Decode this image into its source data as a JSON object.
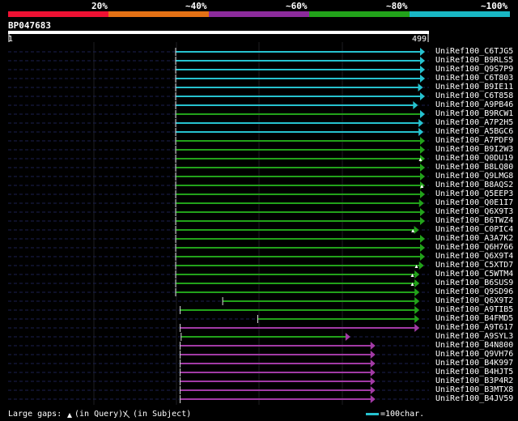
{
  "colors": {
    "bg": "#000000",
    "grid": "#1e1e22",
    "query_bar": "#ffffff",
    "dash": "#1b2050",
    "class_colors": [
      "#ee1133",
      "#e37115",
      "#8c2b9c",
      "#22a21a",
      "#19b7c4"
    ],
    "line_colors": {
      "c": "#26c2cf",
      "g": "#22a21a",
      "m": "#a23aa6"
    }
  },
  "legend": {
    "bins": [
      "20%",
      "~40%",
      "~60%",
      "~80%",
      "~100%"
    ]
  },
  "query": {
    "id": "BP047683",
    "start_label": "1",
    "end_label": "499",
    "length": 499
  },
  "hits": [
    {
      "id": "UniRef100_C6TJG5",
      "color": "c",
      "qs": 1,
      "qe": 499,
      "arrow": "c"
    },
    {
      "id": "UniRef100_B9RLS5",
      "color": "c",
      "qs": 1,
      "qe": 499,
      "arrow": "c"
    },
    {
      "id": "UniRef100_Q9S7P9",
      "color": "c",
      "qs": 1,
      "qe": 499,
      "arrow": "c"
    },
    {
      "id": "UniRef100_C6T803",
      "color": "c",
      "qs": 1,
      "qe": 499,
      "arrow": "c"
    },
    {
      "id": "UniRef100_B9IE11",
      "color": "c",
      "qs": 1,
      "qe": 495,
      "arrow": "c"
    },
    {
      "id": "UniRef100_C6T858",
      "color": "c",
      "qs": 1,
      "qe": 499,
      "arrow": "c"
    },
    {
      "id": "UniRef100_A9PB46",
      "color": "c",
      "qs": 1,
      "qe": 485,
      "arrow": "c"
    },
    {
      "id": "UniRef100_B9RCW1",
      "color": "g",
      "qs": 1,
      "qe": 499,
      "arrow": "c"
    },
    {
      "id": "UniRef100_A7P2H5",
      "color": "c",
      "qs": 1,
      "qe": 496,
      "arrow": "c"
    },
    {
      "id": "UniRef100_A5BGC6",
      "color": "c",
      "qs": 1,
      "qe": 496,
      "arrow": "c"
    },
    {
      "id": "UniRef100_A7PDF9",
      "color": "g",
      "qs": 1,
      "qe": 499,
      "arrow": "g"
    },
    {
      "id": "UniRef100_B9I2W3",
      "color": "g",
      "qs": 1,
      "qe": 499,
      "arrow": "g"
    },
    {
      "id": "UniRef100_Q0DU19",
      "color": "g",
      "qs": 1,
      "qe": 499,
      "arrow": "g",
      "gap": 490
    },
    {
      "id": "UniRef100_B8LQ80",
      "color": "g",
      "qs": 1,
      "qe": 499,
      "arrow": "g"
    },
    {
      "id": "UniRef100_Q9LMG8",
      "color": "g",
      "qs": 1,
      "qe": 499,
      "arrow": "g"
    },
    {
      "id": "UniRef100_B8AQS2",
      "color": "g",
      "qs": 1,
      "qe": 499,
      "arrow": "g",
      "gap": 493
    },
    {
      "id": "UniRef100_Q5EEP3",
      "color": "g",
      "qs": 1,
      "qe": 499,
      "arrow": "g"
    },
    {
      "id": "UniRef100_Q0E1I7",
      "color": "g",
      "qs": 1,
      "qe": 497,
      "arrow": "g"
    },
    {
      "id": "UniRef100_Q6X9T3",
      "color": "g",
      "qs": 1,
      "qe": 499,
      "arrow": "g"
    },
    {
      "id": "UniRef100_B6TWZ4",
      "color": "g",
      "qs": 1,
      "qe": 499,
      "arrow": "g"
    },
    {
      "id": "UniRef100_C0PIC4",
      "color": "g",
      "qs": 1,
      "qe": 487,
      "arrow": "g",
      "gap": 475
    },
    {
      "id": "UniRef100_A3A7K2",
      "color": "g",
      "qs": 1,
      "qe": 499,
      "arrow": "g"
    },
    {
      "id": "UniRef100_Q6H766",
      "color": "g",
      "qs": 1,
      "qe": 499,
      "arrow": "g"
    },
    {
      "id": "UniRef100_Q6X9T4",
      "color": "g",
      "qs": 1,
      "qe": 499,
      "arrow": "g"
    },
    {
      "id": "UniRef100_C5XTD7",
      "color": "g",
      "qs": 1,
      "qe": 497,
      "arrow": "g",
      "gap": 482
    },
    {
      "id": "UniRef100_C5WTM4",
      "color": "g",
      "qs": 1,
      "qe": 488,
      "arrow": "g",
      "gap": 474
    },
    {
      "id": "UniRef100_B6SUS9",
      "color": "g",
      "qs": 1,
      "qe": 488,
      "arrow": "g",
      "gap": 474
    },
    {
      "id": "UniRef100_Q9SD96",
      "color": "g",
      "qs": 1,
      "qe": 488,
      "arrow": "g"
    },
    {
      "id": "UniRef100_Q6X9T2",
      "color": "g",
      "qs": 95,
      "qe": 488,
      "arrow": "g"
    },
    {
      "id": "UniRef100_A9TIB5",
      "color": "g",
      "qs": 10,
      "qe": 488,
      "arrow": "g"
    },
    {
      "id": "UniRef100_B4FMD5",
      "color": "g",
      "qs": 165,
      "qe": 488,
      "arrow": "g"
    },
    {
      "id": "UniRef100_A9T617",
      "color": "m",
      "qs": 10,
      "qe": 488,
      "arrow": "m"
    },
    {
      "id": "UniRef100_A9SYL3",
      "color": "g",
      "qs": 12,
      "qe": 350,
      "arrow": "m"
    },
    {
      "id": "UniRef100_B4N800",
      "color": "m",
      "qs": 10,
      "qe": 400,
      "arrow": "m"
    },
    {
      "id": "UniRef100_Q9VH76",
      "color": "m",
      "qs": 10,
      "qe": 400,
      "arrow": "m"
    },
    {
      "id": "UniRef100_B4K997",
      "color": "m",
      "qs": 10,
      "qe": 400,
      "arrow": "m"
    },
    {
      "id": "UniRef100_B4HJT5",
      "color": "m",
      "qs": 10,
      "qe": 400,
      "arrow": "m"
    },
    {
      "id": "UniRef100_B3P4R2",
      "color": "m",
      "qs": 10,
      "qe": 400,
      "arrow": "m"
    },
    {
      "id": "UniRef100_B3MTX8",
      "color": "m",
      "qs": 10,
      "qe": 400,
      "arrow": "m"
    },
    {
      "id": "UniRef100_B4JV59",
      "color": "m",
      "qs": 10,
      "qe": 400,
      "arrow": "m"
    }
  ],
  "footer": {
    "legend_text": "Large gaps:",
    "query_gap_text": "(in Query)/",
    "subject_gap_text": "(in Subject)",
    "scale_text": "=100char."
  }
}
